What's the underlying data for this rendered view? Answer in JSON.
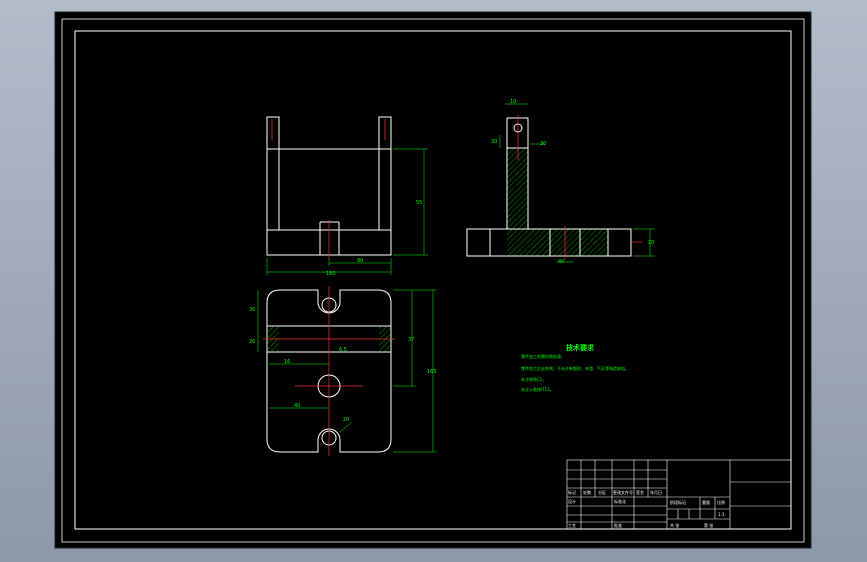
{
  "drawing": {
    "views": {
      "front": [
        "160",
        "80",
        "55"
      ],
      "side": [
        "30",
        "10",
        "40",
        "30",
        "20",
        "160"
      ],
      "top": [
        "30",
        "20",
        "16",
        "40",
        "20",
        "37",
        "165",
        "6.5"
      ]
    },
    "requirements": {
      "title": "技术要求",
      "items": [
        "零件加工前需时效处理。",
        "零件加工后去毛刺，不允许有裂纹、夹渣、气孔等铸造缺陷。",
        "未注倒角C1。",
        "未注公差按IT13。"
      ]
    },
    "title_block": {
      "marking_label": "标记",
      "count_label": "处数",
      "zone_label": "分区",
      "change_doc_label": "更改文件号",
      "signature_label": "签名",
      "date_label": "年月日",
      "design_label": "设计",
      "standardize_label": "标准化",
      "process_label": "工艺",
      "approve_label": "批准",
      "stage_mark_label": "阶段标记",
      "weight_label": "重量",
      "scale_label": "比例",
      "scale_value": "1:1",
      "sheet_total": "共 张",
      "sheet_no": "第 张"
    }
  }
}
